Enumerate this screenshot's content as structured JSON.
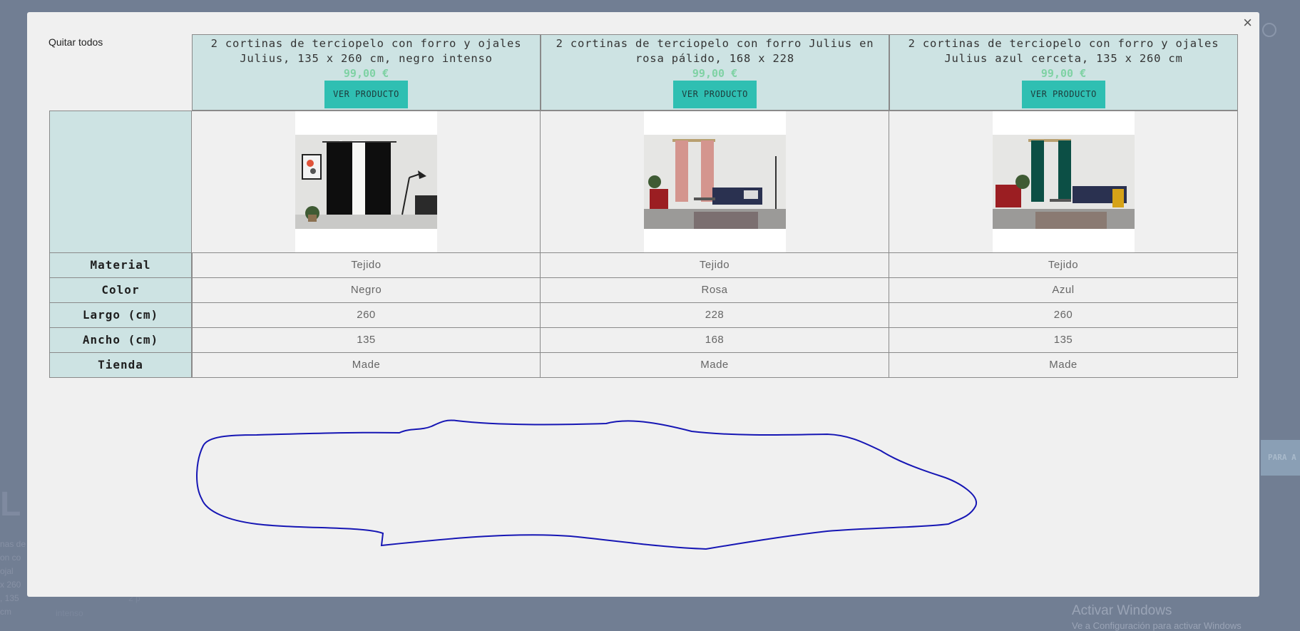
{
  "modal": {
    "close_label": "×",
    "remove_all_label": "Quitar todos"
  },
  "products": [
    {
      "title": "2 cortinas de terciopelo con forro y ojales Julius, 135 x 260 cm, negro intenso",
      "price": "99,00 €",
      "button_label": "VER PRODUCTO",
      "image_alt": "black-curtains-photo",
      "values": [
        "Tejido",
        "Negro",
        "260",
        "135",
        "Made"
      ]
    },
    {
      "title": "2 cortinas de terciopelo con forro Julius en rosa pálido, 168 x 228",
      "price": "99,00 €",
      "button_label": "VER PRODUCTO",
      "image_alt": "pink-curtains-photo",
      "values": [
        "Tejido",
        "Rosa",
        "228",
        "168",
        "Made"
      ]
    },
    {
      "title": "2 cortinas de terciopelo con forro y ojales Julius azul cerceta, 135 x 260 cm",
      "price": "99,00 €",
      "button_label": "VER PRODUCTO",
      "image_alt": "teal-curtains-photo",
      "values": [
        "Tejido",
        "Azul",
        "260",
        "135",
        "Made"
      ]
    }
  ],
  "attributes": [
    "Material",
    "Color",
    "Largo (cm)",
    "Ancho (cm)",
    "Tienda"
  ],
  "background": {
    "watermark_title": "Activar Windows",
    "watermark_sub": "Ve a Configuración para activar Windows",
    "side_button": "PARA A",
    "frag_lines": [
      "nas de",
      "on co",
      "ojal",
      "x 260",
      ", 135",
      "cm"
    ],
    "frag_bottom_a": "intenso",
    "frag_bottom_b": "2 p"
  },
  "colors": {
    "accent_button": "#2fbfb2",
    "header_bg": "#cde3e3",
    "price": "#7fd2a4",
    "doodle": "#1616b4"
  }
}
